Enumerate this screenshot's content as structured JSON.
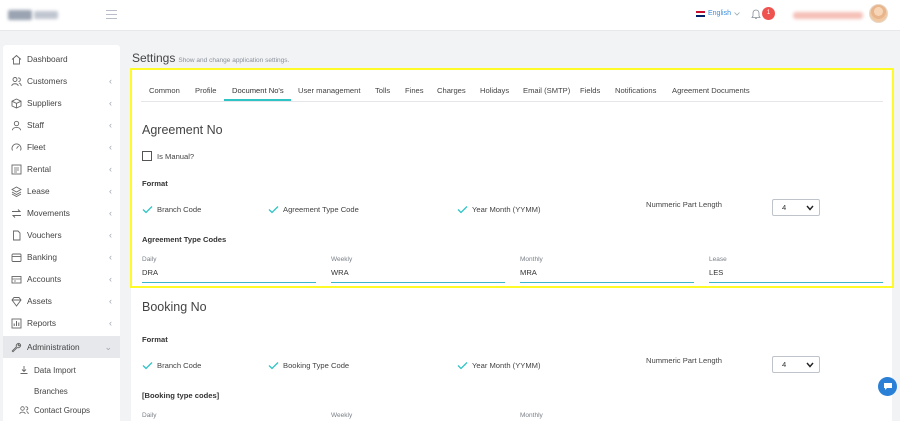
{
  "header": {
    "language": "English",
    "notification_count": "1"
  },
  "sidebar": {
    "items": [
      {
        "label": "Dashboard",
        "icon": "home-icon",
        "chevron": ""
      },
      {
        "label": "Customers",
        "icon": "users-icon",
        "chevron": "‹"
      },
      {
        "label": "Suppliers",
        "icon": "box-icon",
        "chevron": "‹"
      },
      {
        "label": "Staff",
        "icon": "staff-icon",
        "chevron": "‹"
      },
      {
        "label": "Fleet",
        "icon": "speedometer-icon",
        "chevron": "‹"
      },
      {
        "label": "Rental",
        "icon": "list-icon",
        "chevron": "‹"
      },
      {
        "label": "Lease",
        "icon": "layers-icon",
        "chevron": "‹"
      },
      {
        "label": "Movements",
        "icon": "arrows-icon",
        "chevron": "‹"
      },
      {
        "label": "Vouchers",
        "icon": "file-icon",
        "chevron": "‹"
      },
      {
        "label": "Banking",
        "icon": "bank-icon",
        "chevron": "‹"
      },
      {
        "label": "Accounts",
        "icon": "wallet-icon",
        "chevron": "‹"
      },
      {
        "label": "Assets",
        "icon": "diamond-icon",
        "chevron": "‹"
      },
      {
        "label": "Reports",
        "icon": "chart-icon",
        "chevron": "‹"
      },
      {
        "label": "Administration",
        "icon": "wrench-icon",
        "chevron": "⌄"
      }
    ],
    "sub_items": [
      {
        "label": "Data Import",
        "icon": "import-icon"
      },
      {
        "label": "Branches",
        "icon": "branch-icon"
      },
      {
        "label": "Contact Groups",
        "icon": "group-icon"
      }
    ]
  },
  "page": {
    "title": "Settings",
    "subtitle": "Show and change application settings."
  },
  "tabs": [
    {
      "label": "Common"
    },
    {
      "label": "Profile"
    },
    {
      "label": "Document No's"
    },
    {
      "label": "User management"
    },
    {
      "label": "Tolls"
    },
    {
      "label": "Fines"
    },
    {
      "label": "Charges"
    },
    {
      "label": "Holidays"
    },
    {
      "label": "Email (SMTP)"
    },
    {
      "label": "Fields"
    },
    {
      "label": "Notifications"
    },
    {
      "label": "Agreement Documents"
    }
  ],
  "agreement": {
    "title": "Agreement No",
    "is_manual_label": "Is Manual?",
    "format_label": "Format",
    "format_items": [
      "Branch Code",
      "Agreement Type Code",
      "Year Month (YYMM)"
    ],
    "numeric_part_label": "Nummeric Part Length",
    "numeric_part_value": "4",
    "codes_label": "Agreement Type Codes",
    "codes": [
      {
        "label": "Daily",
        "value": "DRA"
      },
      {
        "label": "Weekly",
        "value": "WRA"
      },
      {
        "label": "Monthly",
        "value": "MRA"
      },
      {
        "label": "Lease",
        "value": "LES"
      }
    ]
  },
  "booking": {
    "title": "Booking No",
    "format_label": "Format",
    "format_items": [
      "Branch Code",
      "Booking Type Code",
      "Year Month (YYMM)"
    ],
    "numeric_part_label": "Nummeric Part Length",
    "numeric_part_value": "4",
    "codes_label": "[Booking type codes]",
    "codes": [
      {
        "label": "Daily"
      },
      {
        "label": "Weekly"
      },
      {
        "label": "Monthly"
      }
    ]
  },
  "colors": {
    "accent": "#2ec4c6",
    "highlight": "#fffb28",
    "badge": "#ef5350",
    "chat": "#2a7fd6"
  }
}
